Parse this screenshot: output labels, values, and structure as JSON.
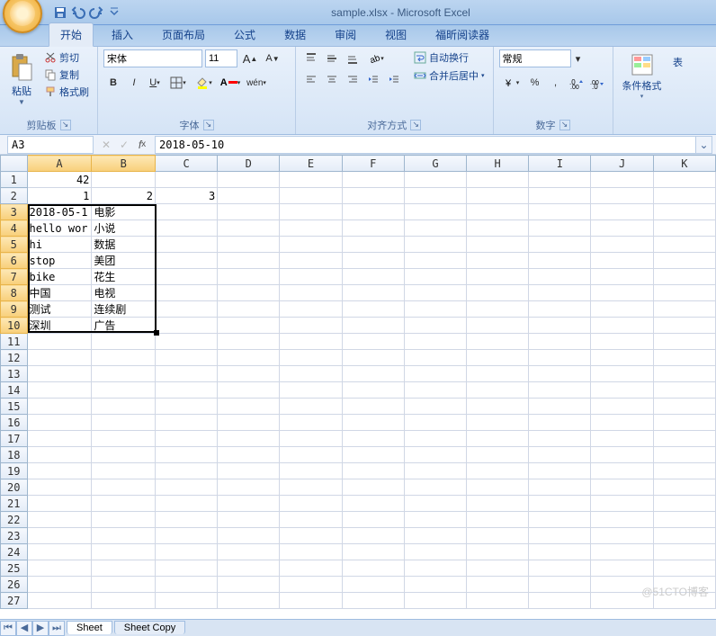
{
  "title": "sample.xlsx - Microsoft Excel",
  "ribbon_tabs": [
    "开始",
    "插入",
    "页面布局",
    "公式",
    "数据",
    "审阅",
    "视图",
    "福昕阅读器"
  ],
  "active_tab": 0,
  "clipboard": {
    "paste": "粘贴",
    "cut": "剪切",
    "copy": "复制",
    "fmtpaint": "格式刷",
    "group": "剪贴板"
  },
  "font": {
    "name": "宋体",
    "size": "11",
    "group": "字体"
  },
  "align": {
    "wrap": "自动换行",
    "merge": "合并后居中",
    "group": "对齐方式"
  },
  "number": {
    "format": "常规",
    "group": "数字"
  },
  "styles": {
    "condfmt": "条件格式",
    "tablefmt": "表"
  },
  "namebox": "A3",
  "formula": "2018-05-10",
  "columns": [
    "A",
    "B",
    "C",
    "D",
    "E",
    "F",
    "G",
    "H",
    "I",
    "J",
    "K"
  ],
  "row_count": 27,
  "cells": {
    "A1": {
      "v": "42",
      "num": true
    },
    "A2": {
      "v": "1",
      "num": true
    },
    "B2": {
      "v": "2",
      "num": true
    },
    "C2": {
      "v": "3",
      "num": true
    },
    "A3": {
      "v": "2018-05-1"
    },
    "B3": {
      "v": "电影"
    },
    "A4": {
      "v": "hello wor"
    },
    "B4": {
      "v": "小说"
    },
    "A5": {
      "v": "hi"
    },
    "B5": {
      "v": "数据"
    },
    "A6": {
      "v": "stop"
    },
    "B6": {
      "v": "美团"
    },
    "A7": {
      "v": "bike"
    },
    "B7": {
      "v": "花生"
    },
    "A8": {
      "v": "中国"
    },
    "B8": {
      "v": "电视"
    },
    "A9": {
      "v": "测试"
    },
    "B9": {
      "v": "连续剧"
    },
    "A10": {
      "v": "深圳"
    },
    "B10": {
      "v": "广告"
    }
  },
  "selection": {
    "r1": 3,
    "c1": 1,
    "r2": 10,
    "c2": 2
  },
  "sheets": [
    "Sheet",
    "Sheet Copy"
  ],
  "active_sheet": 0,
  "watermark": "@51CTO博客"
}
